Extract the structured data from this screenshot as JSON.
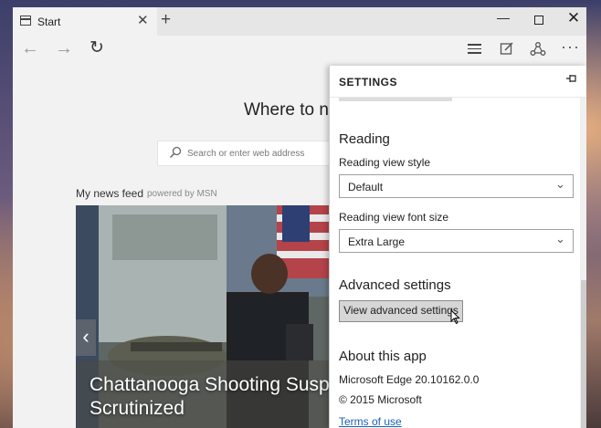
{
  "browser": {
    "tab_title": "Start",
    "tab_close": "✕",
    "new_tab": "+",
    "window_controls": {
      "minimize": "—",
      "close": "✕"
    },
    "toolbar_icons": [
      "back-arrow-icon",
      "forward-arrow-icon",
      "refresh-icon",
      "hub-icon",
      "web-note-icon",
      "share-icon",
      "more-icon"
    ]
  },
  "page": {
    "heading": "Where to n",
    "search_placeholder": "Search or enter web address",
    "feed_title": "My news feed",
    "feed_powered_by": "powered by MSN",
    "news_caption": "Chattanooga Shooting Susp\nScrutinized"
  },
  "settings": {
    "title": "SETTINGS",
    "reading": {
      "heading": "Reading",
      "view_style_label": "Reading view style",
      "view_style_value": "Default",
      "font_size_label": "Reading view font size",
      "font_size_value": "Extra Large"
    },
    "advanced": {
      "heading": "Advanced settings",
      "button_label": "View advanced settings"
    },
    "about": {
      "heading": "About this app",
      "version": "Microsoft Edge 20.10162.0.0",
      "copyright": "© 2015 Microsoft",
      "terms_link": "Terms of use"
    }
  },
  "colors": {
    "link": "#1a5fb4",
    "chrome_bg": "#f2f2f2",
    "panel_bg": "#ffffff"
  }
}
